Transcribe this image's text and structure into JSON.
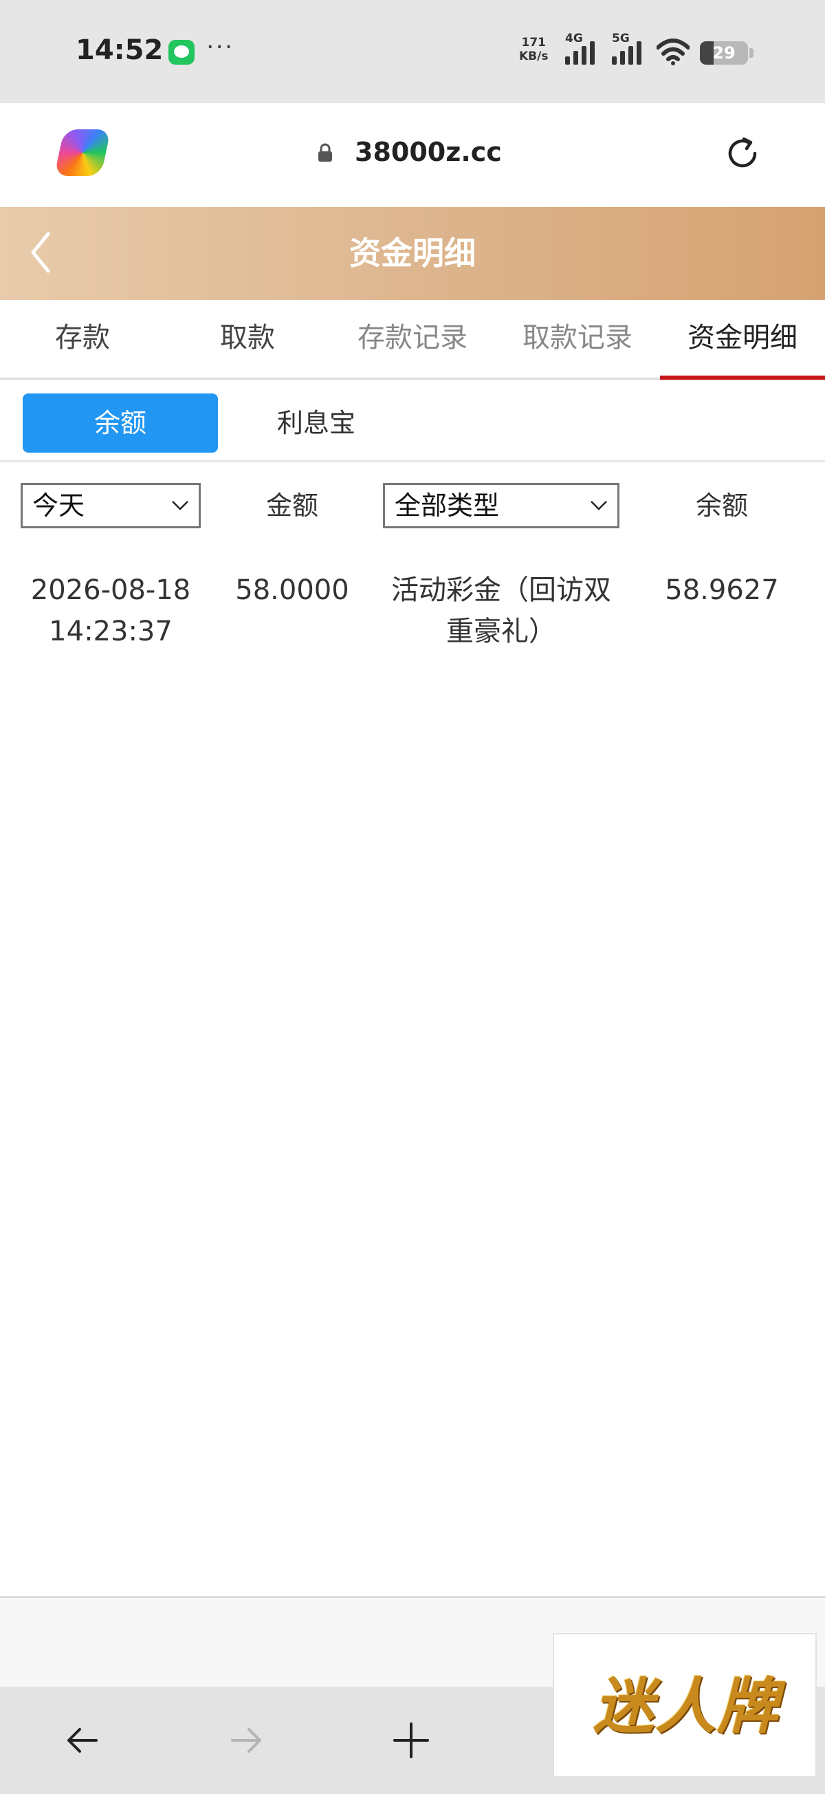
{
  "status_bar": {
    "time": "14:52",
    "net_speed_value": "171",
    "net_speed_unit": "KB/s",
    "signal_1_label": "4G",
    "signal_2_label": "5G",
    "battery_level": "29"
  },
  "browser": {
    "url": "38000z.cc"
  },
  "header": {
    "title": "资金明细"
  },
  "tabs": [
    {
      "label": "存款"
    },
    {
      "label": "取款"
    },
    {
      "label": "存款记录"
    },
    {
      "label": "取款记录"
    },
    {
      "label": "资金明细"
    }
  ],
  "subtabs": {
    "balance": "余额",
    "interest": "利息宝"
  },
  "filters": {
    "date_selected": "今天",
    "type_selected": "全部类型"
  },
  "columns": {
    "amount": "金额",
    "balance": "余额"
  },
  "records": [
    {
      "date": "2026-08-18",
      "time": "14:23:37",
      "amount": "58.0000",
      "type_line1": "活动彩金（回访双",
      "type_line2": "重豪礼）",
      "balance": "58.9627"
    }
  ],
  "ad": {
    "text": "迷人牌"
  },
  "colors": {
    "header_gradient_start": "#e8cbab",
    "header_gradient_end": "#d6a271",
    "active_tab_underline": "#c8161d",
    "subtab_active_bg": "#2196f3"
  }
}
